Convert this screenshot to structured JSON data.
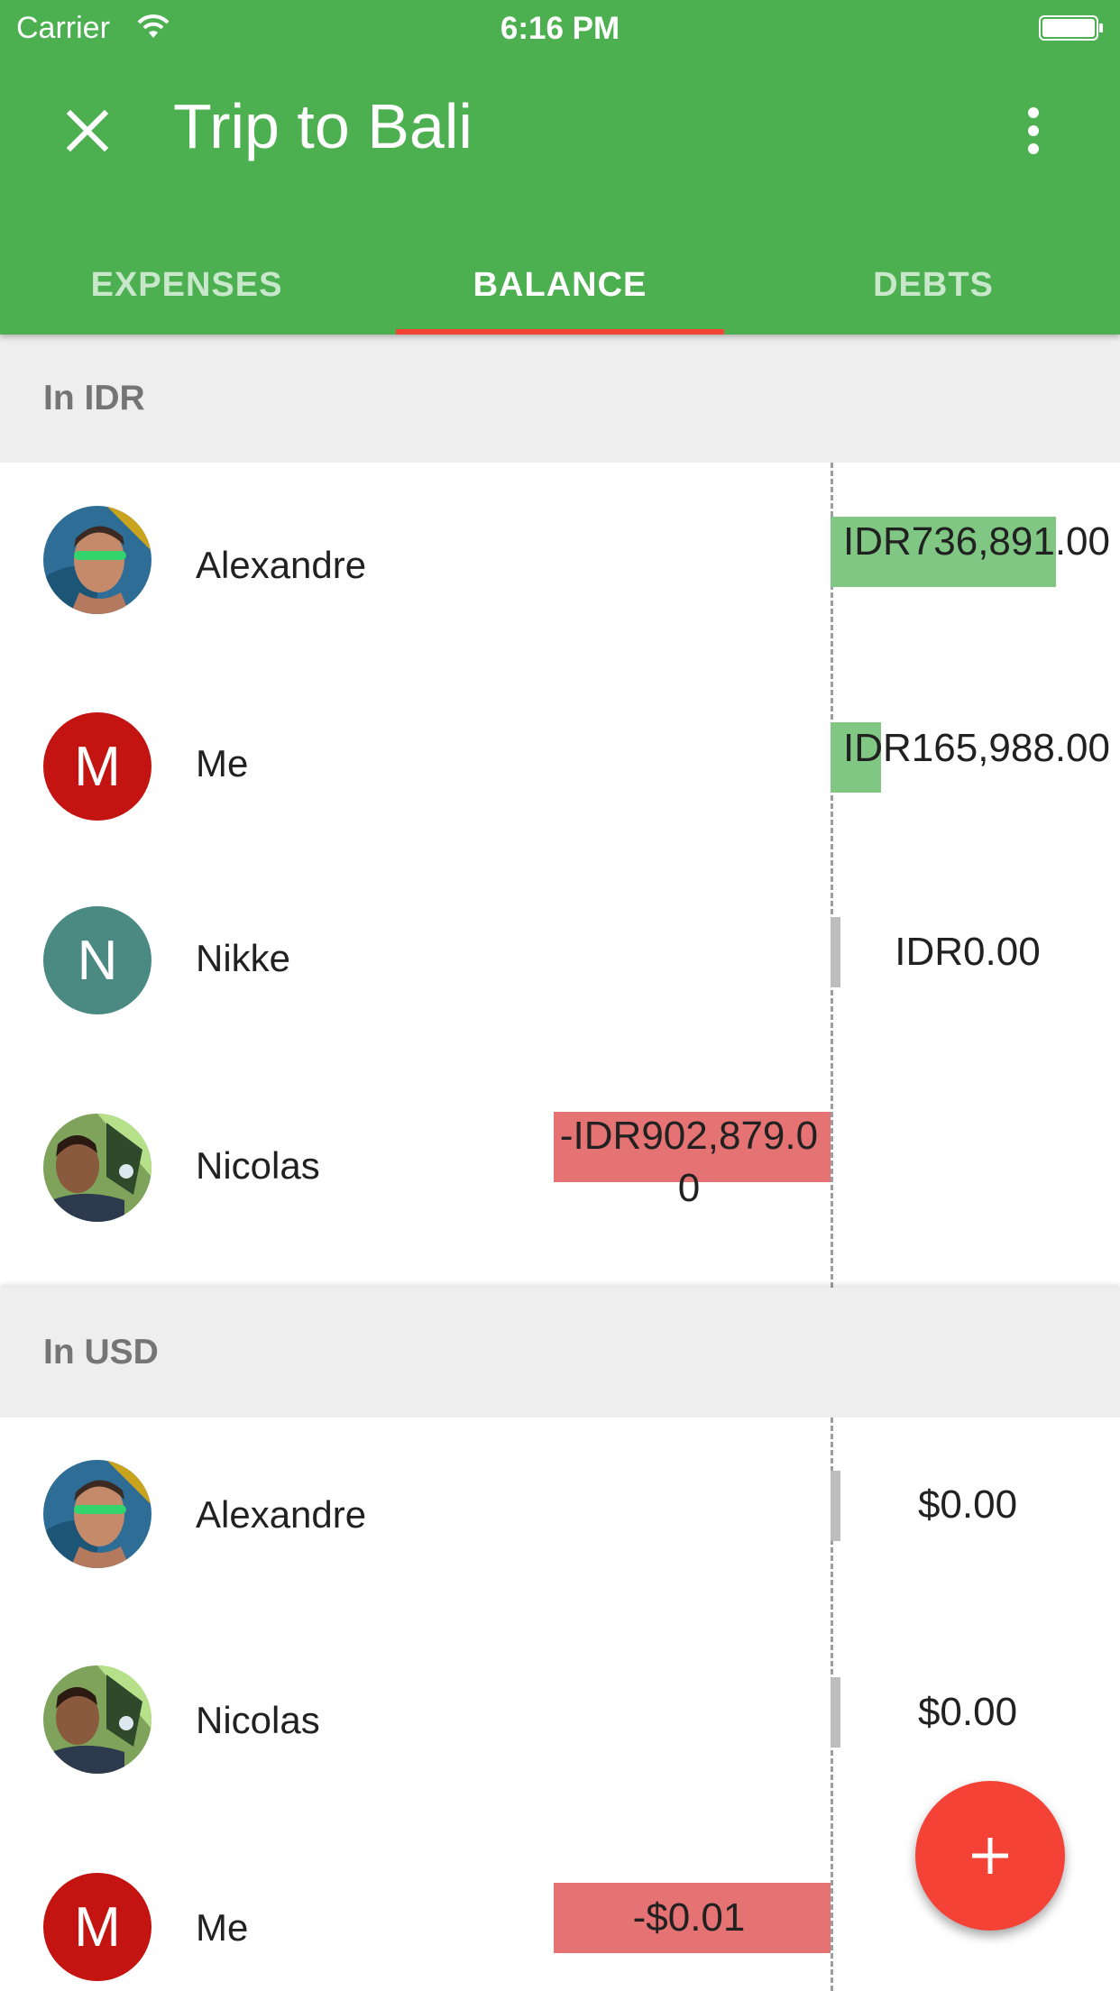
{
  "status_bar": {
    "carrier": "Carrier",
    "time": "6:16 PM",
    "wifi_icon": "wifi-icon",
    "battery_icon": "battery-icon"
  },
  "toolbar": {
    "title": "Trip to Bali",
    "close_icon": "close-icon",
    "more_icon": "more-vert-icon"
  },
  "tabs": [
    {
      "label": "EXPENSES",
      "active": false
    },
    {
      "label": "BALANCE",
      "active": true
    },
    {
      "label": "DEBTS",
      "active": false
    }
  ],
  "sections": [
    {
      "header": "In IDR",
      "rows": [
        {
          "name": "Alexandre",
          "avatar": "photo",
          "amount": "IDR736,891.00",
          "balance": 736891,
          "sign": "positive"
        },
        {
          "name": "Me",
          "avatar": "M",
          "avatar_color": "#C41411",
          "amount": "IDR165,988.00",
          "balance": 165988,
          "sign": "positive"
        },
        {
          "name": "Nikke",
          "avatar": "N",
          "avatar_color": "#4A8A82",
          "amount": "IDR0.00",
          "balance": 0,
          "sign": "zero"
        },
        {
          "name": "Nicolas",
          "avatar": "photo",
          "amount": "-IDR902,879.00",
          "balance": -902879,
          "sign": "negative"
        }
      ]
    },
    {
      "header": "In USD",
      "rows": [
        {
          "name": "Alexandre",
          "avatar": "photo",
          "amount": "$0.00",
          "balance": 0,
          "sign": "zero"
        },
        {
          "name": "Nicolas",
          "avatar": "photo",
          "amount": "$0.00",
          "balance": 0,
          "sign": "zero"
        },
        {
          "name": "Me",
          "avatar": "M",
          "avatar_color": "#C41411",
          "amount": "-$0.01",
          "balance": -0.01,
          "sign": "negative"
        }
      ]
    }
  ],
  "colors": {
    "primary": "#4CAF50",
    "accent": "#F44336",
    "positive_bar": "#81C784",
    "negative_bar": "#E57373",
    "zero_bar": "#BDBDBD"
  },
  "fab": {
    "icon": "add-icon"
  }
}
